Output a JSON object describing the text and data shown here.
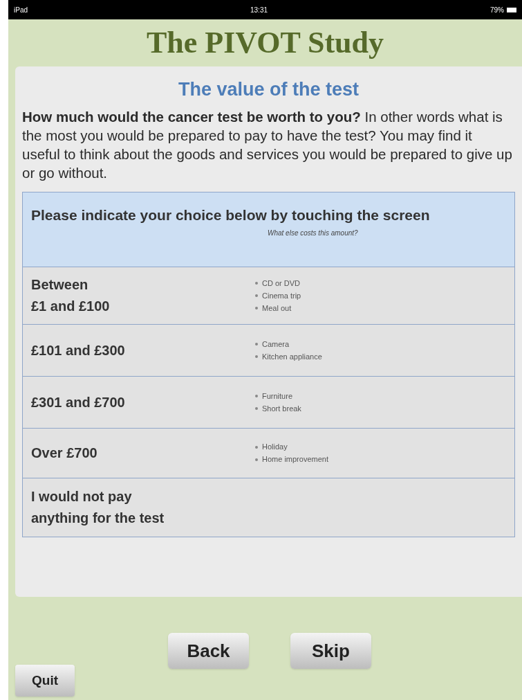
{
  "status_bar": {
    "device": "iPad",
    "time": "13:31",
    "battery": "79%"
  },
  "app_title": "The PIVOT Study",
  "panel": {
    "heading": "The value of the test",
    "intro": "**How much would the cancer test be worth to you?** In other words what is the most you would be prepared to pay to have the test? You may find it useful to think about the goods and services you would be prepared to give up or go without.",
    "table": {
      "instruction": "Please indicate your choice below by touching the screen",
      "examples_heading": "What else costs this amount?",
      "options": [
        {
          "label": "Between\n£1 and £100",
          "examples": [
            "CD or DVD",
            "Cinema trip",
            "Meal out"
          ]
        },
        {
          "label": "£101 and £300",
          "examples": [
            "Camera",
            "Kitchen appliance"
          ]
        },
        {
          "label": "£301 and £700",
          "examples": [
            "Furniture",
            "Short break"
          ]
        },
        {
          "label": "Over £700",
          "examples": [
            "Holiday",
            "Home improvement"
          ]
        },
        {
          "label": "I would not pay\nanything for the test"
        }
      ]
    }
  },
  "buttons": [
    "Back",
    "Skip"
  ],
  "quit": "Quit"
}
